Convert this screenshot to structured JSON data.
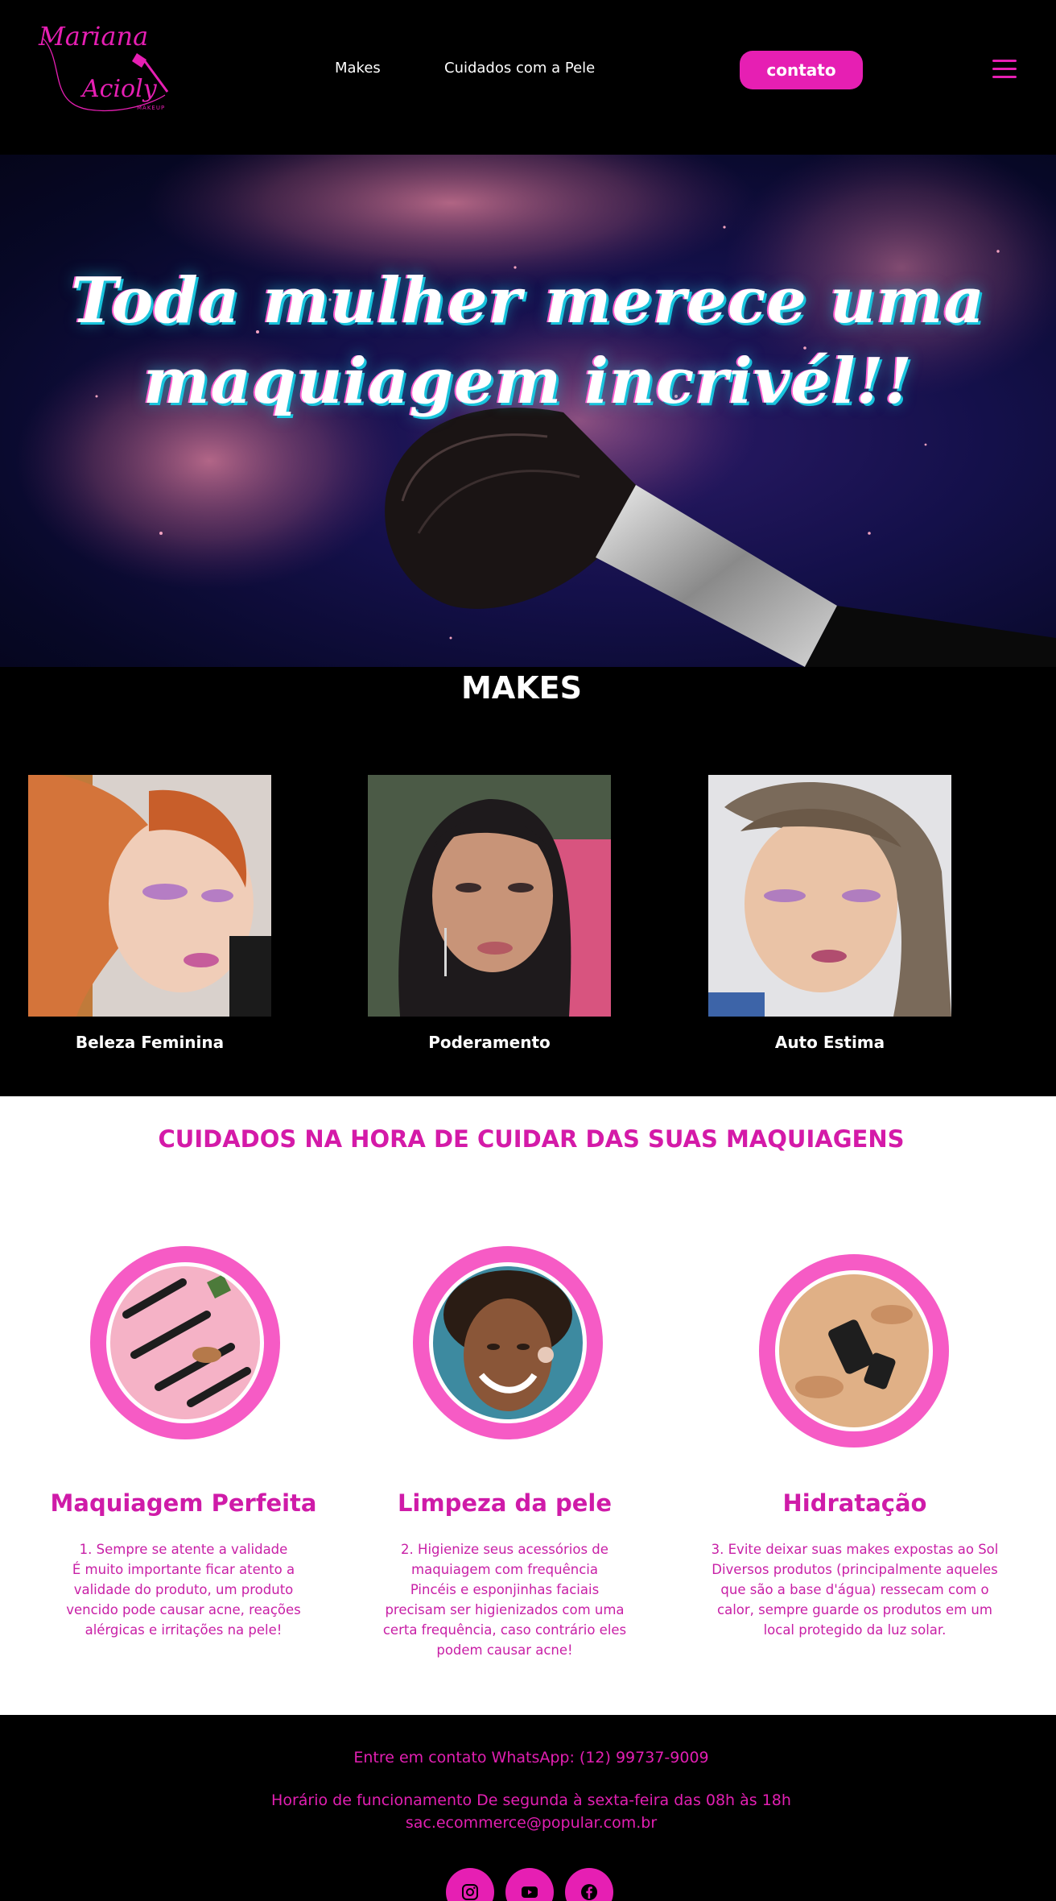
{
  "brand": {
    "logo_script_line1": "Mariana",
    "logo_script_line2": "Acioly",
    "logo_sub": "MAKEUP",
    "accent_color": "#e61fb3",
    "accent_text_color": "#d41aa8"
  },
  "nav": {
    "items": [
      {
        "label": "Makes"
      },
      {
        "label": "Cuidados com a Pele"
      }
    ],
    "contact_button": "contato",
    "menu_icon": "hamburger-menu-icon"
  },
  "hero": {
    "title": "Toda mulher merece uma maquiagem incrivél!!"
  },
  "makes": {
    "title": "MAKES",
    "cards": [
      {
        "caption": "Beleza Feminina"
      },
      {
        "caption": "Poderamento"
      },
      {
        "caption": "Auto Estima"
      }
    ]
  },
  "cuidados": {
    "title": "CUIDADOS NA HORA DE CUIDAR DAS SUAS MAQUIAGENS",
    "items": [
      {
        "heading": "Maquiagem Perfeita",
        "lines": [
          "1. Sempre se atente a validade",
          "É muito importante ficar atento a",
          "validade do produto, um produto",
          "vencido pode causar acne, reações",
          "alérgicas e irritações na pele!"
        ]
      },
      {
        "heading": "Limpeza da pele",
        "lines": [
          "2. Higienize seus acessórios de",
          "maquiagem com frequência",
          "Pincéis e esponjinhas faciais",
          "precisam ser higienizados com uma",
          "certa frequência, caso contrário eles",
          "podem causar acne!"
        ]
      },
      {
        "heading": "Hidratação",
        "lines": [
          "3. Evite deixar suas makes expostas ao Sol",
          "Diversos produtos (principalmente aqueles",
          "que são a base d'água) ressecam com o",
          "calor, sempre guarde os produtos em um",
          "local protegido da luz solar."
        ]
      }
    ]
  },
  "footer": {
    "whatsapp": "Entre em contato WhatsApp: (12) 99737-9009",
    "hours": "Horário de funcionamento De segunda à sexta-feira das 08h às 18h",
    "email": "sac.ecommerce@popular.com.br",
    "social_icons": [
      "instagram-icon",
      "youtube-icon",
      "facebook-icon"
    ]
  }
}
